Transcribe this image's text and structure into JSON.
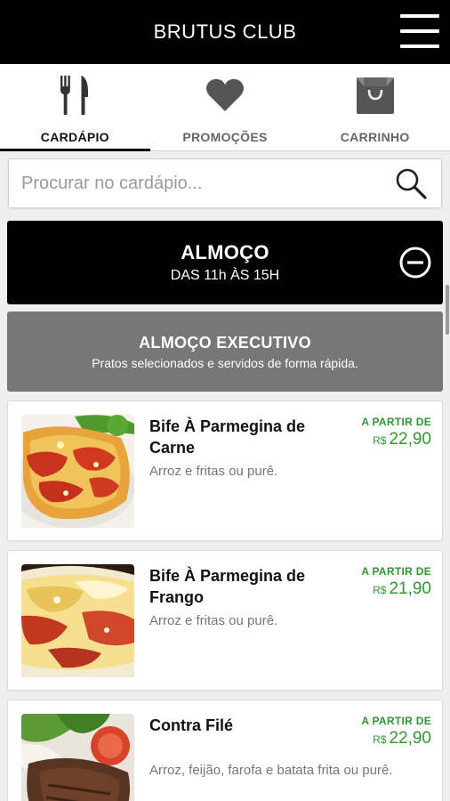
{
  "header": {
    "title": "BRUTUS CLUB",
    "menu_icon": "hamburger-menu-icon"
  },
  "tabs": [
    {
      "label": "CARDÁPIO",
      "icon": "fork-knife-icon",
      "active": true
    },
    {
      "label": "PROMOÇÕES",
      "icon": "heart-icon",
      "active": false
    },
    {
      "label": "CARRINHO",
      "icon": "shopping-bag-icon",
      "active": false
    }
  ],
  "search": {
    "placeholder": "Procurar no cardápio...",
    "value": "",
    "icon": "search-icon"
  },
  "section": {
    "title": "ALMOÇO",
    "subtitle": "DAS 11h ÀS 15H",
    "icon": "collapse-minus-icon"
  },
  "subsection": {
    "title": "ALMOÇO EXECUTIVO",
    "description": "Pratos selecionados e servidos de forma rápida."
  },
  "items": [
    {
      "name": "Bife À Parmegina de Carne",
      "description": "Arroz e fritas ou purê.",
      "price_from": "A PARTIR DE",
      "currency": "R$",
      "price": "22,90"
    },
    {
      "name": "Bife À Parmegina de Frango",
      "description": "Arroz e fritas ou purê.",
      "price_from": "A PARTIR DE",
      "currency": "R$",
      "price": "21,90"
    },
    {
      "name": "Contra Filé",
      "description": "Arroz, feijão, farofa e batata frita ou purê.",
      "price_from": "A PARTIR DE",
      "currency": "R$",
      "price": "22,90"
    }
  ],
  "colors": {
    "header_bg": "#000000",
    "price_green": "#2e9a2e",
    "subsection_bg": "#777777",
    "page_bg": "#efefef"
  }
}
